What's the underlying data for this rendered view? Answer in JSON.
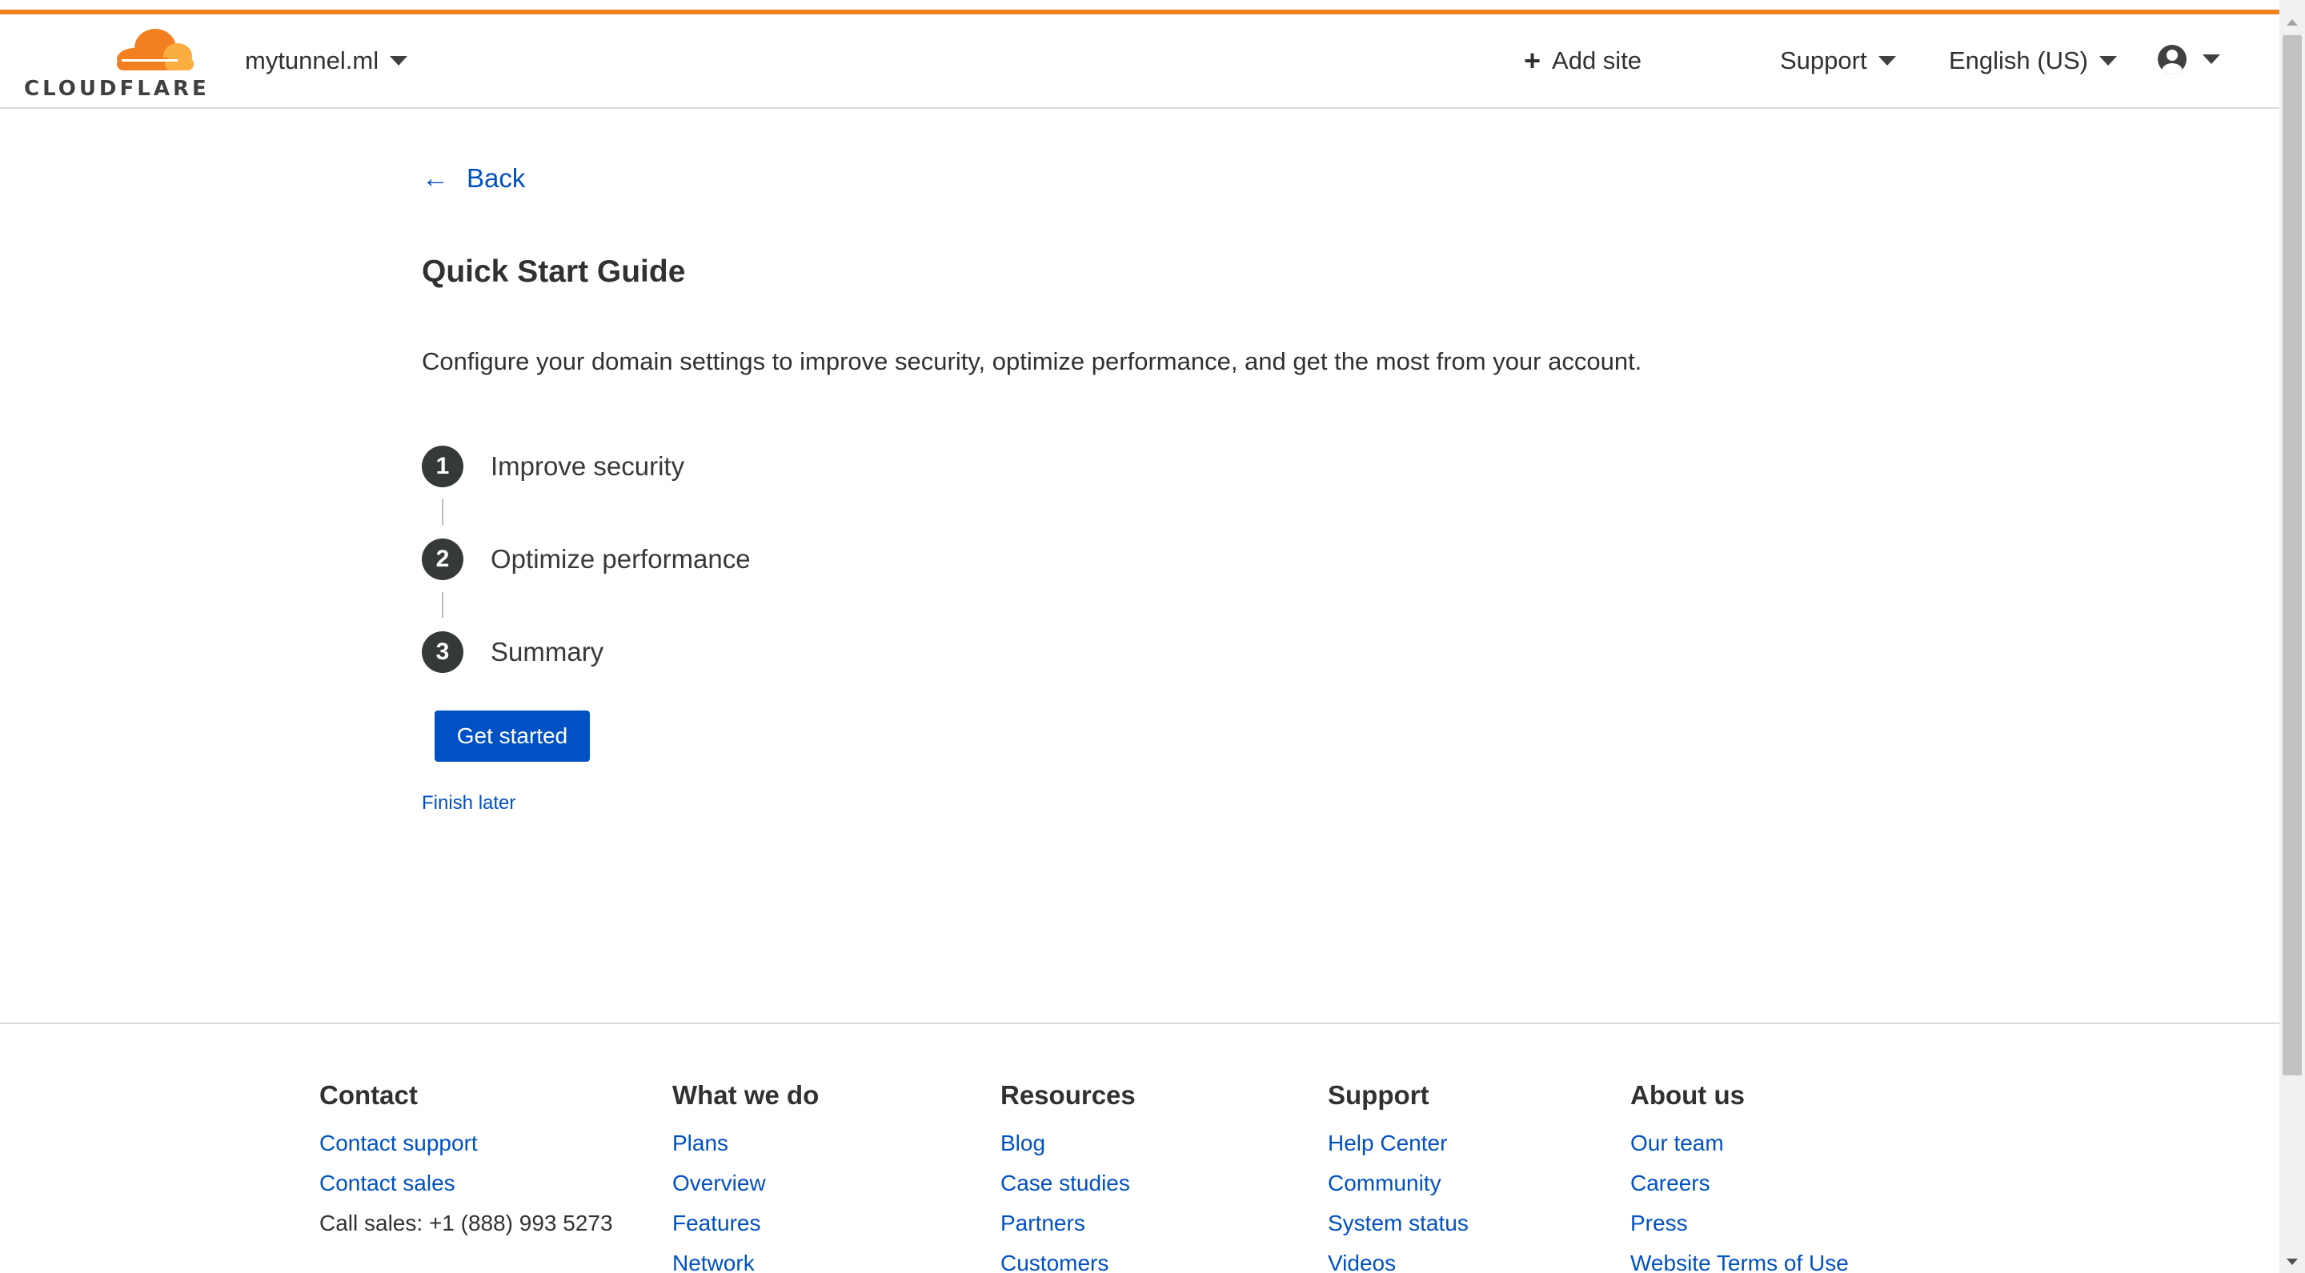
{
  "header": {
    "logo_text": "CLOUDFLARE",
    "domain": "mytunnel.ml",
    "add_site": "Add site",
    "support": "Support",
    "language": "English (US)"
  },
  "main": {
    "back": "Back",
    "title": "Quick Start Guide",
    "intro": "Configure your domain settings to improve security, optimize performance, and get the most from your account.",
    "steps": [
      {
        "number": "1",
        "label": "Improve security"
      },
      {
        "number": "2",
        "label": "Optimize performance"
      },
      {
        "number": "3",
        "label": "Summary"
      }
    ],
    "get_started": "Get started",
    "finish_later": "Finish later"
  },
  "footer": {
    "columns": [
      {
        "heading": "Contact",
        "items": [
          "Contact support",
          "Contact sales",
          "Call sales: +1 (888) 993 5273"
        ]
      },
      {
        "heading": "What we do",
        "items": [
          "Plans",
          "Overview",
          "Features",
          "Network"
        ]
      },
      {
        "heading": "Resources",
        "items": [
          "Blog",
          "Case studies",
          "Partners",
          "Customers"
        ]
      },
      {
        "heading": "Support",
        "items": [
          "Help Center",
          "Community",
          "System status",
          "Videos"
        ]
      },
      {
        "heading": "About us",
        "items": [
          "Our team",
          "Careers",
          "Press",
          "Website Terms of Use"
        ]
      }
    ]
  },
  "colors": {
    "brand_orange": "#f38020",
    "link_blue": "#0051c3",
    "step_circle": "#36393a"
  }
}
